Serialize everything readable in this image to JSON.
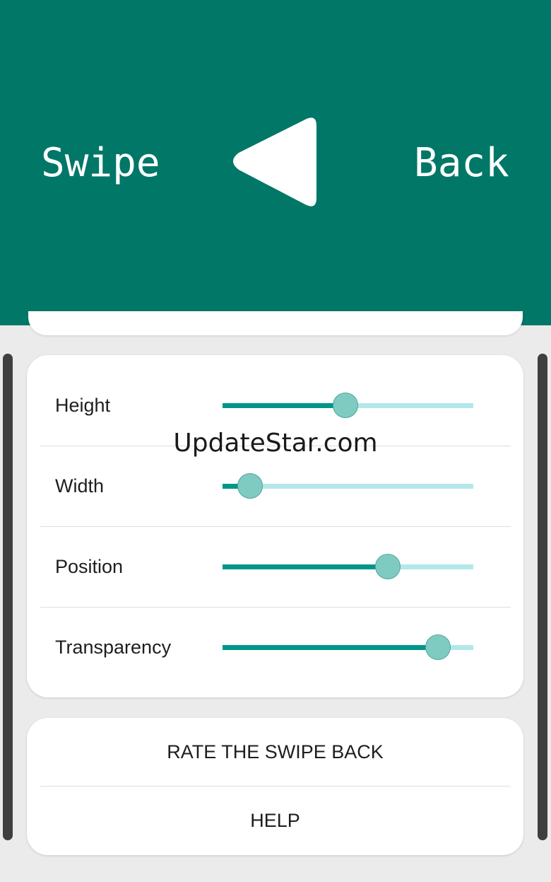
{
  "header": {
    "left_word": "Swipe",
    "right_word": "Back",
    "arrow_icon": "back-triangle-icon",
    "background_color": "#007767"
  },
  "settings": {
    "sliders": [
      {
        "label": "Height",
        "value": 0.49
      },
      {
        "label": "Width",
        "value": 0.11
      },
      {
        "label": "Position",
        "value": 0.66
      },
      {
        "label": "Transparency",
        "value": 0.86
      }
    ],
    "track_color": "#b3e8ea",
    "fill_color": "#00968b",
    "thumb_color": "#80cbc1"
  },
  "actions": {
    "rate_label": "RATE THE SWIPE BACK",
    "help_label": "HELP"
  },
  "watermark": "UpdateStar.com"
}
